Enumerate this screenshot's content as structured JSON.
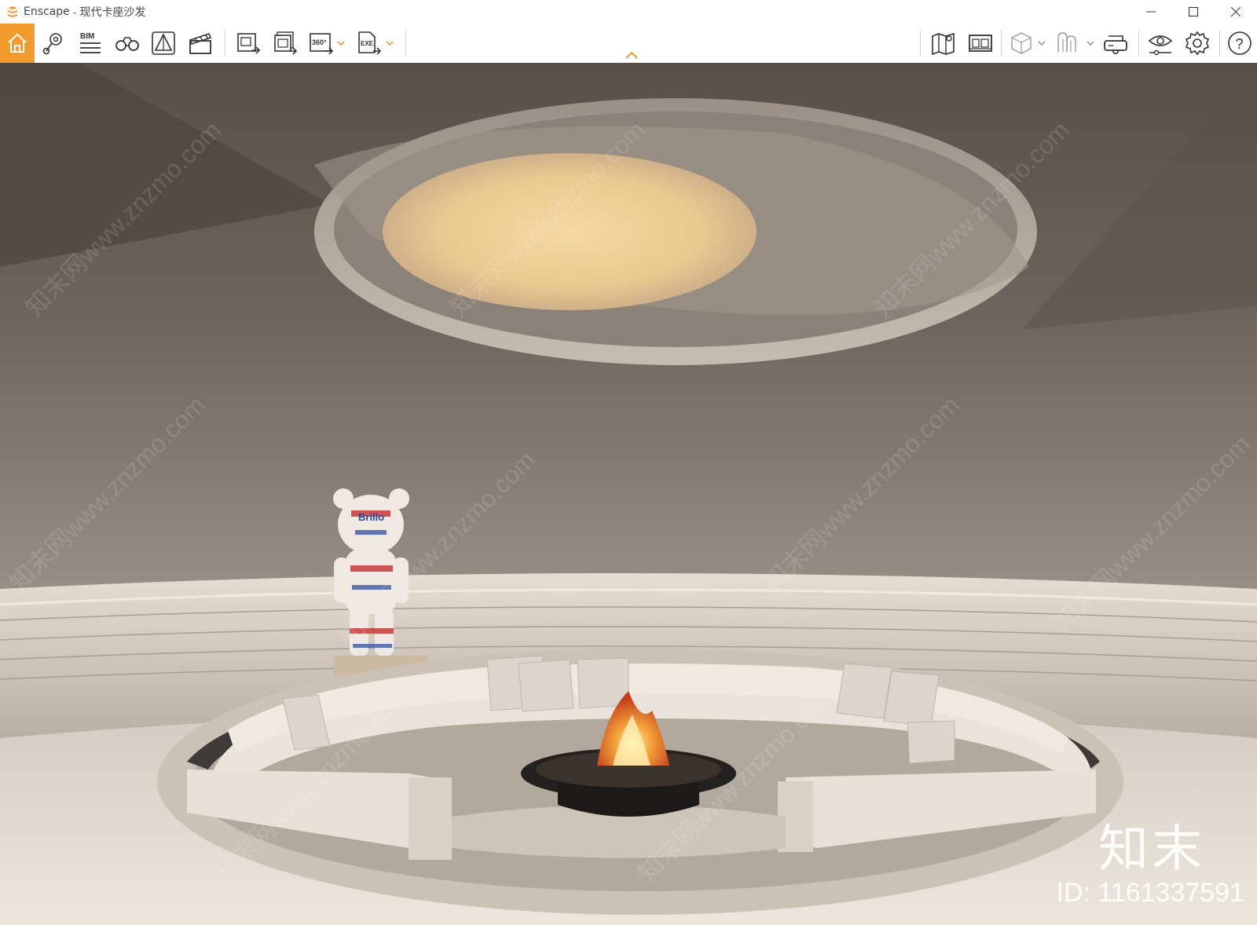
{
  "window": {
    "app_name": "Enscape",
    "separator": "-",
    "document_title": "现代卡座沙发",
    "controls": [
      "minimize-icon",
      "maximize-icon",
      "close-icon"
    ]
  },
  "toolbar": {
    "accent_color": "#f39a2c",
    "left_tools": [
      {
        "name": "home",
        "icon": "home-icon",
        "active": true
      },
      {
        "name": "views",
        "icon": "map-pin-icon"
      },
      {
        "name": "bim",
        "icon": "bim-icon",
        "label": "BIM"
      },
      {
        "name": "binoculars",
        "icon": "binoculars-icon"
      },
      {
        "name": "asset-library",
        "icon": "asset-library-icon"
      },
      {
        "name": "video-editor",
        "icon": "clapperboard-icon"
      },
      {
        "name": "screenshot",
        "icon": "export-image-icon"
      },
      {
        "name": "batch-render",
        "icon": "batch-render-icon"
      },
      {
        "name": "panorama",
        "icon": "panorama-360-icon",
        "label": "360°"
      },
      {
        "name": "exe-export",
        "icon": "exe-export-icon",
        "label": "EXE"
      }
    ],
    "right_tools": [
      {
        "name": "map",
        "icon": "map-icon"
      },
      {
        "name": "capture-manager",
        "icon": "capture-icon"
      },
      {
        "name": "orthographic",
        "icon": "cube-icon"
      },
      {
        "name": "clip",
        "icon": "clip-icon"
      },
      {
        "name": "vr-headset",
        "icon": "vr-headset-icon"
      },
      {
        "name": "visual-settings",
        "icon": "eye-settings-icon"
      },
      {
        "name": "settings",
        "icon": "gear-icon"
      },
      {
        "name": "help",
        "icon": "help-icon",
        "label": "?"
      }
    ]
  },
  "viewport": {
    "watermark_brand": "知末",
    "watermark_id": "ID: 1161337591",
    "watermark_repeat": "知末网www.znzmo.com",
    "sculpture_text": "Brillo"
  }
}
